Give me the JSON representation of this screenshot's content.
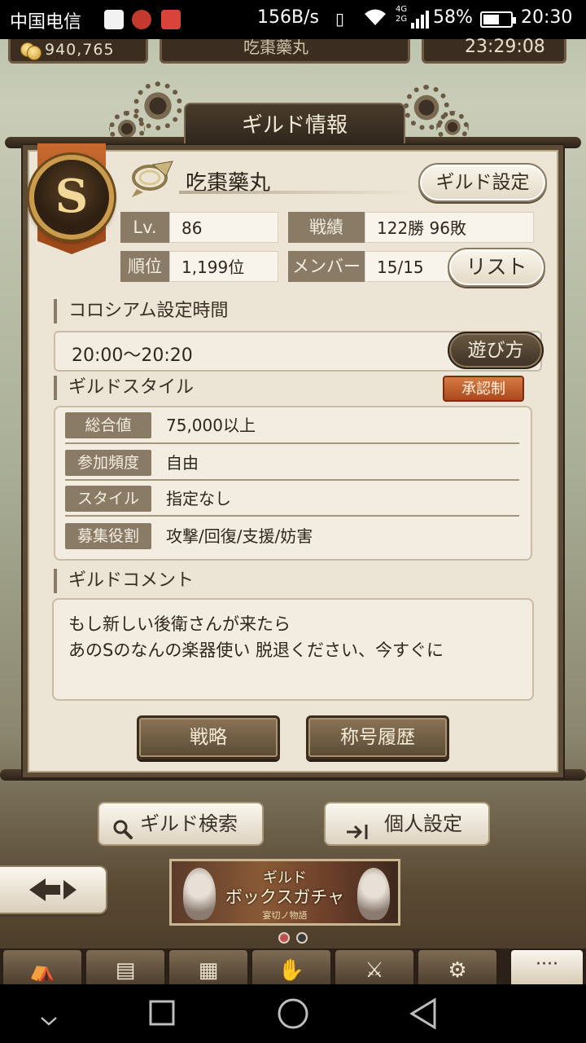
{
  "status_bar": {
    "carrier": "中国电信",
    "network_speed": "156B/s",
    "battery": "58%",
    "battery_level": 0.58,
    "time": "20:30",
    "network_type_top": "4G",
    "network_type_bottom": "2G"
  },
  "top_bar": {
    "coins": "940,765",
    "timer": "23:29:08"
  },
  "panel": {
    "title": "ギルド情報",
    "rank_letter": "S",
    "guild_name": "吃棗藥丸",
    "guild_settings_button": "ギルド設定",
    "stats": {
      "level_label": "Lv.",
      "level_value": "86",
      "record_label": "戦績",
      "record_value": "122勝 96敗",
      "rank_label": "順位",
      "rank_value": "1,199位",
      "members_label": "メンバー",
      "members_value": "15/15"
    },
    "list_button": "リスト",
    "colosseum": {
      "section_title": "コロシアム設定時間",
      "time_range": "20:00～20:20",
      "howto_button": "遊び方"
    },
    "style": {
      "section_title": "ギルドスタイル",
      "approval_badge": "承認制",
      "rows": [
        {
          "label": "総合値",
          "value": "75,000以上"
        },
        {
          "label": "参加頻度",
          "value": "自由"
        },
        {
          "label": "スタイル",
          "value": "指定なし"
        },
        {
          "label": "募集役割",
          "value": "攻撃/回復/支援/妨害"
        }
      ]
    },
    "comment": {
      "section_title": "ギルドコメント",
      "line1": "もし新しい後衛さんが来たら",
      "line2": "あのSのなんの楽器使い 脱退ください、今すぐに"
    },
    "strategy_button": "戦略",
    "title_history_button": "称号履歴"
  },
  "lower_actions": {
    "guild_search_button": "ギルド検索",
    "personal_settings_button": "個人設定"
  },
  "promo_banner": {
    "title_line1": "ギルド",
    "title_line2": "ボックスガチャ",
    "subtitle": "宴切ノ物語"
  },
  "bottom_nav": {
    "more_label": "····"
  },
  "icons": {
    "coin": "coin-icon",
    "search": "search-icon",
    "personal": "enter-arrow-icon",
    "back": "back-arrow-icon"
  },
  "colors": {
    "panel_bg": "#ece4d4",
    "panel_border": "#5b4b37",
    "label_bg": "#8a7b66",
    "approval_badge": "#c4622c",
    "rank_emblem_ring": "#c99b4a"
  }
}
